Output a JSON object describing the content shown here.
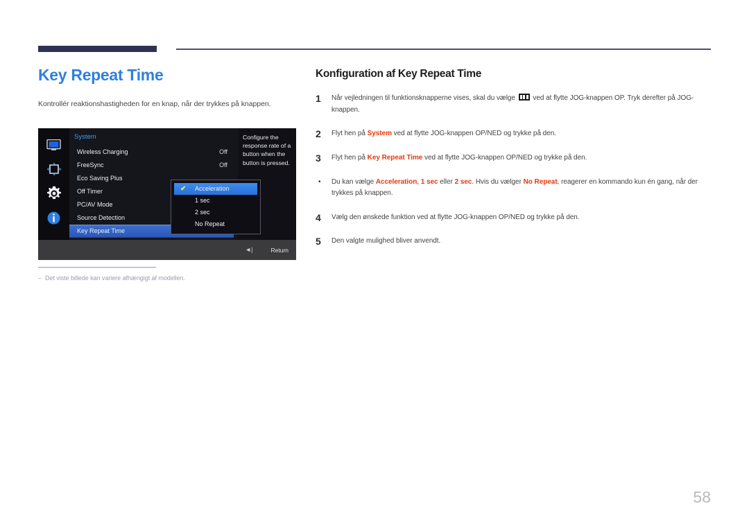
{
  "page": {
    "title": "Key Repeat Time",
    "subtitle": "Kontrollér reaktionshastigheden for en knap, når der trykkes på knappen.",
    "number": "58"
  },
  "footnote": {
    "dash": "–",
    "text": "Det viste billede kan variere afhængigt af modellen."
  },
  "osd": {
    "menu_title": "System",
    "sidebar_icons": [
      {
        "name": "display-icon"
      },
      {
        "name": "picture-size-icon"
      },
      {
        "name": "system-gear-icon"
      },
      {
        "name": "information-icon"
      }
    ],
    "items": [
      {
        "label": "Wireless Charging",
        "value": "Off",
        "selected": false
      },
      {
        "label": "FreeSync",
        "value": "Off",
        "selected": false
      },
      {
        "label": "Eco Saving Plus",
        "value": "",
        "selected": false
      },
      {
        "label": "Off Timer",
        "value": "",
        "selected": false
      },
      {
        "label": "PC/AV Mode",
        "value": "",
        "selected": false
      },
      {
        "label": "Source Detection",
        "value": "",
        "selected": false
      },
      {
        "label": "Key Repeat Time",
        "value": "",
        "selected": true
      }
    ],
    "description": "Configure the response rate of a button when the button is pressed.",
    "popup_options": [
      {
        "label": "Acceleration",
        "selected": true,
        "check": "✔"
      },
      {
        "label": "1 sec",
        "selected": false,
        "check": ""
      },
      {
        "label": "2 sec",
        "selected": false,
        "check": ""
      },
      {
        "label": "No Repeat",
        "selected": false,
        "check": ""
      }
    ],
    "bottom_bar": {
      "back_icon": "◄|",
      "return_label": "Return"
    }
  },
  "instructions": {
    "heading": "Konfiguration af Key Repeat Time",
    "steps": [
      {
        "num": "1",
        "kind": "number",
        "parts": [
          {
            "t": "Når vejledningen til funktionsknapperne vises, skal du vælge ",
            "s": "plain"
          },
          {
            "t": "",
            "s": "menu-glyph"
          },
          {
            "t": " ved at flytte JOG-knappen OP. Tryk derefter på JOG-knappen.",
            "s": "plain"
          }
        ]
      },
      {
        "num": "2",
        "kind": "number",
        "parts": [
          {
            "t": "Flyt hen på ",
            "s": "plain"
          },
          {
            "t": "System",
            "s": "hl"
          },
          {
            "t": " ved at flytte JOG-knappen OP/NED og trykke på den.",
            "s": "plain"
          }
        ]
      },
      {
        "num": "3",
        "kind": "number",
        "parts": [
          {
            "t": "Flyt hen på ",
            "s": "plain"
          },
          {
            "t": "Key Repeat Time",
            "s": "hl"
          },
          {
            "t": " ved at flytte JOG-knappen OP/NED og trykke på den.",
            "s": "plain"
          }
        ]
      },
      {
        "num": "•",
        "kind": "bullet",
        "parts": [
          {
            "t": "Du kan vælge ",
            "s": "plain"
          },
          {
            "t": "Acceleration",
            "s": "hl"
          },
          {
            "t": ", ",
            "s": "plain"
          },
          {
            "t": "1 sec",
            "s": "hl"
          },
          {
            "t": " eller ",
            "s": "plain"
          },
          {
            "t": "2 sec",
            "s": "hl"
          },
          {
            "t": ". Hvis du vælger ",
            "s": "plain"
          },
          {
            "t": "No Repeat",
            "s": "hl"
          },
          {
            "t": ", reagerer en kommando kun én gang, når der trykkes på knappen.",
            "s": "plain"
          }
        ]
      },
      {
        "num": "4",
        "kind": "number",
        "parts": [
          {
            "t": "Vælg den ønskede funktion ved at flytte JOG-knappen OP/NED og trykke på den.",
            "s": "plain"
          }
        ]
      },
      {
        "num": "5",
        "kind": "number",
        "parts": [
          {
            "t": "Den valgte mulighed bliver anvendt.",
            "s": "plain"
          }
        ]
      }
    ]
  },
  "colors": {
    "title_blue": "#2f7fe0",
    "rule_navy": "#2e3254",
    "highlight_red": "#e8380d",
    "osd_select_blue": "#2a6fd8"
  }
}
